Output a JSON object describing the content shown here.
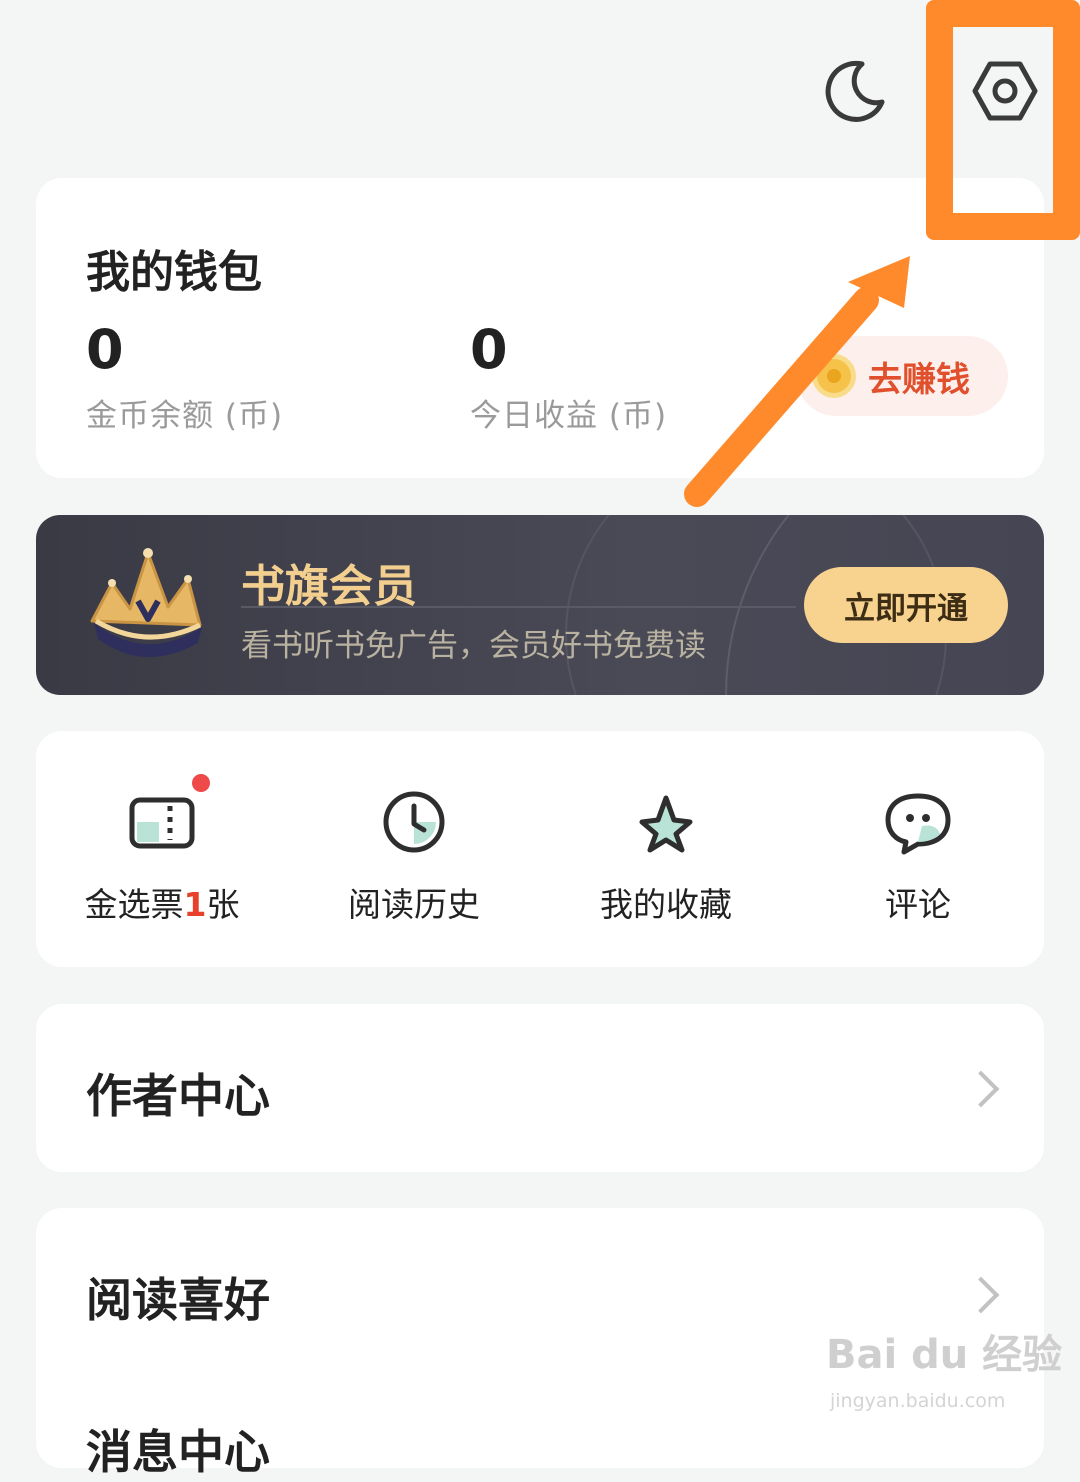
{
  "header": {
    "night_mode_icon": "moon-icon",
    "settings_icon": "settings-hexagon-icon"
  },
  "wallet": {
    "title": "我的钱包",
    "coin_balance": {
      "value": "0",
      "label": "金币余额 (币)"
    },
    "today_earnings": {
      "value": "0",
      "label": "今日收益 (币)"
    },
    "earn_button": "去赚钱"
  },
  "vip": {
    "title": "书旗会员",
    "subtitle": "看书听书免广告，会员好书免费读",
    "button": "立即开通"
  },
  "shortcuts": [
    {
      "label_prefix": "金选票",
      "label_number": "1",
      "label_suffix": "张",
      "icon": "ticket-icon"
    },
    {
      "label": "阅读历史",
      "icon": "clock-icon"
    },
    {
      "label": "我的收藏",
      "icon": "star-icon"
    },
    {
      "label": "评论",
      "icon": "comment-bubble-icon"
    }
  ],
  "menu": [
    {
      "label": "作者中心"
    },
    {
      "label": "阅读喜好"
    },
    {
      "label": "消息中心"
    }
  ],
  "watermark": {
    "brand": "Bai du 经验",
    "url": "jingyan.baidu.com"
  },
  "colors": {
    "highlight": "#ff8a2b",
    "vip_gold": "#f2cf8e",
    "accent_red": "#e0502d"
  }
}
